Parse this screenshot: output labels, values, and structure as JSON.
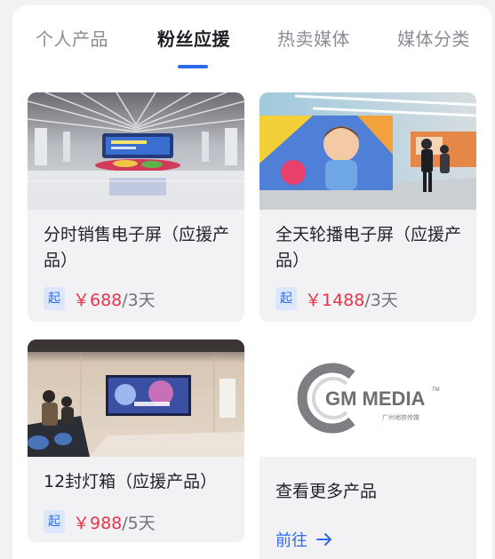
{
  "tabs": [
    {
      "label": "个人产品",
      "active": false
    },
    {
      "label": "粉丝应援",
      "active": true
    },
    {
      "label": "热卖媒体",
      "active": false
    },
    {
      "label": "媒体分类",
      "active": false
    }
  ],
  "cards": [
    {
      "title": "分时销售电子屏（应援产品）",
      "badge": "起",
      "price": "￥688",
      "period": "/3天",
      "image": "station-hall-led-screen"
    },
    {
      "title": "全天轮播电子屏（应援产品）",
      "badge": "起",
      "price": "￥1488",
      "period": "/3天",
      "image": "corridor-child-ad-screen"
    },
    {
      "title": "12封灯箱（应援产品）",
      "badge": "起",
      "price": "￥988",
      "period": "/5天",
      "image": "escalator-lightbox-ad"
    }
  ],
  "more": {
    "logo_name": "GM MEDIA",
    "logo_tm": "TM",
    "logo_sub": "广州地铁传媒",
    "text": "查看更多产品",
    "link": "前往"
  },
  "colors": {
    "accent": "#2a6bf0",
    "price": "#e8344b",
    "badge_bg": "#dce7fb",
    "card_bg": "#f2f2f4"
  }
}
